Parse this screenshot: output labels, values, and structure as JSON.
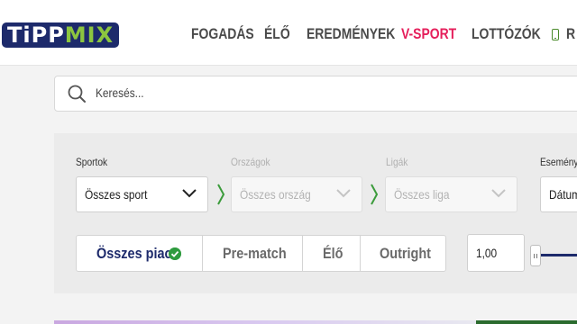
{
  "header": {
    "logo": {
      "part1": "TiPP",
      "part2": "MIX"
    },
    "nav": [
      {
        "label": "FOGADÁS",
        "active": false
      },
      {
        "label": "ÉLŐ",
        "active": false
      },
      {
        "label": "EREDMÉNYEK",
        "active": false
      },
      {
        "label": "V-SPORT",
        "active": true
      },
      {
        "label": "LOTTÓZÓK",
        "active": false
      }
    ],
    "nav_partial": "R",
    "nav_partial_icon": "phone-icon"
  },
  "search": {
    "placeholder": "Keresés..."
  },
  "filters": {
    "sports": {
      "label": "Sportok",
      "value": "Összes sport"
    },
    "countries": {
      "label": "Országok",
      "value": "Összes ország"
    },
    "leagues": {
      "label": "Ligák",
      "value": "Összes liga"
    },
    "event": {
      "label": "Esemény i",
      "value": "Dátum"
    }
  },
  "market_tabs": [
    {
      "label": "Összes piac",
      "active": true
    },
    {
      "label": "Pre-match",
      "active": false
    },
    {
      "label": "Élő",
      "active": false
    },
    {
      "label": "Outright",
      "active": false
    }
  ],
  "odds": {
    "min_value": "1,00"
  },
  "colors": {
    "brand_navy": "#1d2a6b",
    "brand_green": "#8cc63f",
    "active_pink": "#e51f5b",
    "check_green": "#2e9b3e"
  }
}
